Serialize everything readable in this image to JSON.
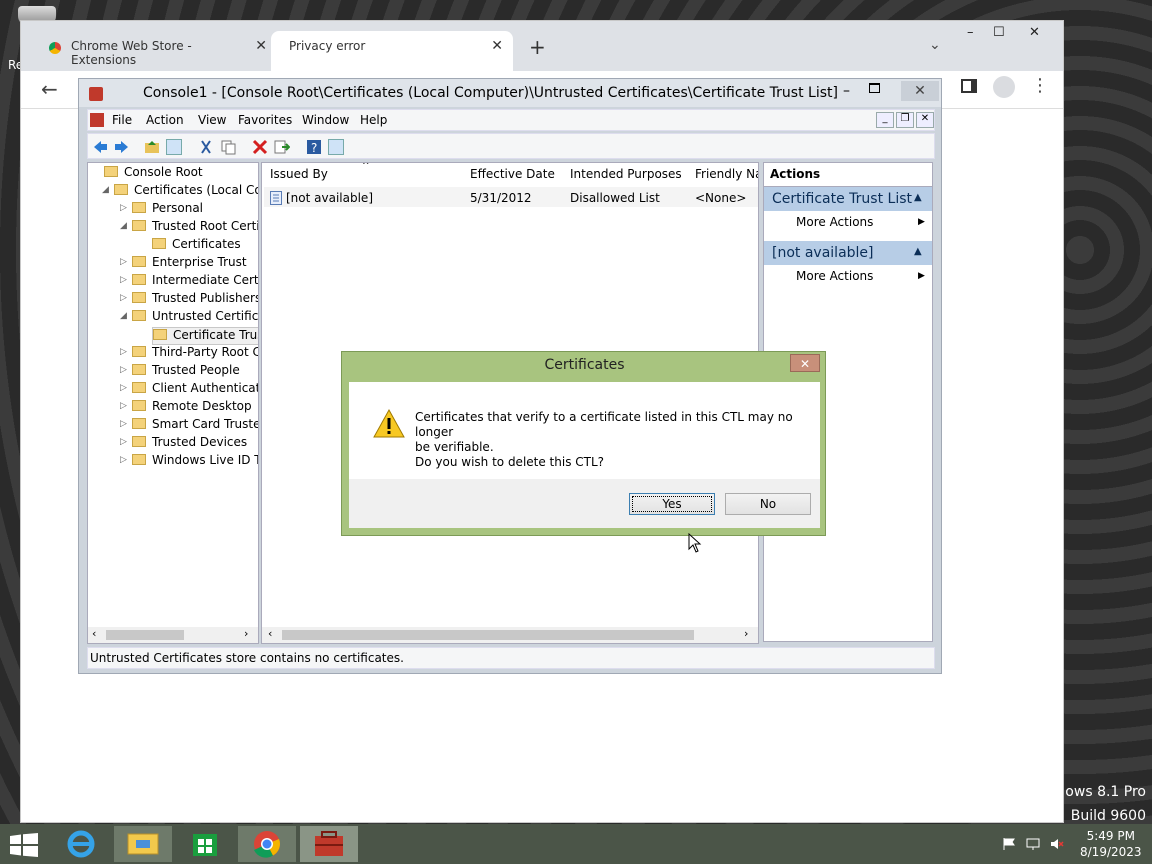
{
  "desktop": {
    "recycle_label": "Re",
    "watermark_line1": "dows 8.1 Pro",
    "watermark_line2": "Build 9600"
  },
  "chrome": {
    "tabs": [
      {
        "label": "Chrome Web Store - Extensions"
      },
      {
        "label": "Privacy error"
      }
    ],
    "new_tab": "+",
    "tab_close": "✕",
    "dropdown": "⌄",
    "win_min": "–",
    "win_max": "☐",
    "win_close": "✕",
    "back": "←",
    "menu": "⋮"
  },
  "mmc": {
    "title": "Console1 - [Console Root\\Certificates (Local Computer)\\Untrusted Certificates\\Certificate Trust List]",
    "menus": [
      "File",
      "Action",
      "View",
      "Favorites",
      "Window",
      "Help"
    ],
    "tree": [
      {
        "label": "Console Root",
        "level": 0,
        "expander": ""
      },
      {
        "label": "Certificates (Local Comp",
        "level": 1,
        "expander": "◢"
      },
      {
        "label": "Personal",
        "level": 2,
        "expander": "▷"
      },
      {
        "label": "Trusted Root Certific",
        "level": 2,
        "expander": "◢"
      },
      {
        "label": "Certificates",
        "level": 3,
        "expander": ""
      },
      {
        "label": "Enterprise Trust",
        "level": 2,
        "expander": "▷"
      },
      {
        "label": "Intermediate Certific",
        "level": 2,
        "expander": "▷"
      },
      {
        "label": "Trusted Publishers",
        "level": 2,
        "expander": "▷"
      },
      {
        "label": "Untrusted Certificate",
        "level": 2,
        "expander": "◢"
      },
      {
        "label": "Certificate Trust",
        "level": 3,
        "expander": ""
      },
      {
        "label": "Third-Party Root Ce",
        "level": 2,
        "expander": "▷"
      },
      {
        "label": "Trusted People",
        "level": 2,
        "expander": "▷"
      },
      {
        "label": "Client Authenticatio",
        "level": 2,
        "expander": "▷"
      },
      {
        "label": "Remote Desktop",
        "level": 2,
        "expander": "▷"
      },
      {
        "label": "Smart Card Trusted",
        "level": 2,
        "expander": "▷"
      },
      {
        "label": "Trusted Devices",
        "level": 2,
        "expander": "▷"
      },
      {
        "label": "Windows Live ID Tol",
        "level": 2,
        "expander": "▷"
      }
    ],
    "columns": [
      "Issued By",
      "Effective Date",
      "Intended Purposes",
      "Friendly Nar"
    ],
    "rows": [
      {
        "issued_by": "[not available]",
        "effective_date": "5/31/2012",
        "purposes": "Disallowed List",
        "friendly": "<None>"
      }
    ],
    "actions": {
      "header": "Actions",
      "section1": "Certificate Trust List",
      "section1_item": "More Actions",
      "section2": "[not available]",
      "section2_item": "More Actions"
    },
    "status": "Untrusted Certificates store contains no certificates."
  },
  "dialog": {
    "title": "Certificates",
    "close": "✕",
    "message_line1": "Certificates that verify to a certificate listed in this CTL may no longer",
    "message_line2": "be verifiable.",
    "message_line3": "Do you wish to delete this CTL?",
    "yes": "Yes",
    "no": "No"
  },
  "taskbar": {
    "time": "5:49 PM",
    "date": "8/19/2023"
  }
}
